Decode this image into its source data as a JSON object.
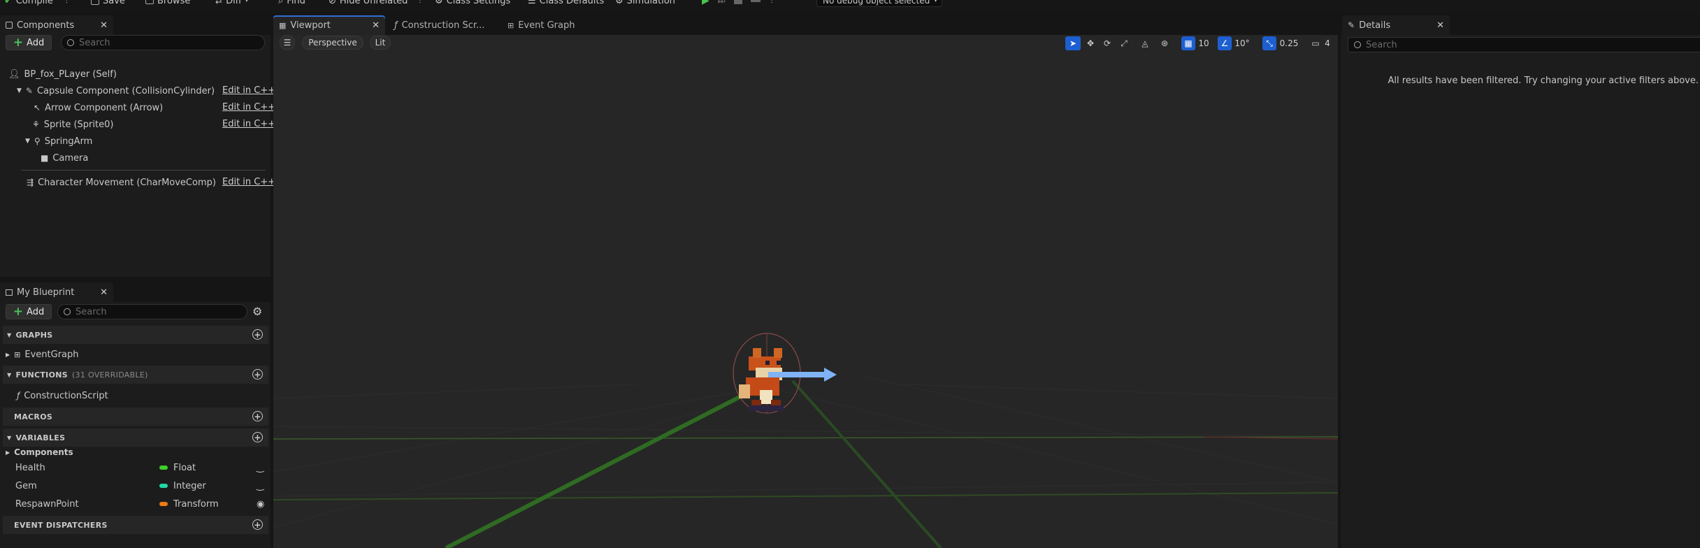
{
  "toolbar": {
    "items": [
      {
        "label": "Compile",
        "icon": "compile-icon"
      },
      {
        "label": "Save",
        "icon": "save-icon"
      },
      {
        "label": "Browse",
        "icon": "browse-icon"
      },
      {
        "label": "Diff",
        "icon": "diff-icon"
      },
      {
        "label": "Find",
        "icon": "find-icon"
      },
      {
        "label": "Hide Unrelated",
        "icon": "hide-unrelated-icon"
      },
      {
        "label": "Class Settings",
        "icon": "class-settings-icon"
      },
      {
        "label": "Class Defaults",
        "icon": "class-defaults-icon"
      },
      {
        "label": "Simulation",
        "icon": "simulation-icon"
      }
    ],
    "debug_selector": "No debug object selected"
  },
  "components_panel": {
    "tab_label": "Components",
    "add_label": "Add",
    "search_placeholder": "Search",
    "root": "BP_fox_PLayer (Self)",
    "items": [
      {
        "label": "Capsule Component (CollisionCylinder)",
        "edit": "Edit in C++"
      },
      {
        "label": "Arrow Component (Arrow)",
        "edit": "Edit in C++"
      },
      {
        "label": "Sprite (Sprite0)",
        "edit": "Edit in C++"
      },
      {
        "label": "SpringArm",
        "edit": ""
      },
      {
        "label": "Camera",
        "edit": ""
      },
      {
        "label": "Character Movement (CharMoveComp)",
        "edit": "Edit in C++"
      }
    ]
  },
  "my_blueprint": {
    "tab_label": "My Blueprint",
    "add_label": "Add",
    "search_placeholder": "Search",
    "sections": {
      "graphs": {
        "title": "GRAPHS",
        "items": [
          "EventGraph"
        ]
      },
      "functions": {
        "title": "FUNCTIONS",
        "subtitle": "(31 OVERRIDABLE)",
        "items": [
          "ConstructionScript"
        ]
      },
      "macros": {
        "title": "MACROS"
      },
      "variables": {
        "title": "VARIABLES",
        "category": "Components"
      },
      "dispatchers": {
        "title": "EVENT DISPATCHERS"
      }
    },
    "variables": [
      {
        "name": "Health",
        "type": "Float",
        "color": "#3fce2a",
        "visibility": "closed-eye-icon"
      },
      {
        "name": "Gem",
        "type": "Integer",
        "color": "#1fd8a6",
        "visibility": "closed-eye-icon"
      },
      {
        "name": "RespawnPoint",
        "type": "Transform",
        "color": "#f07b13",
        "visibility": "open-eye-icon"
      }
    ]
  },
  "editor_tabs": {
    "viewport": "Viewport",
    "construction": "Construction Scr...",
    "event_graph": "Event Graph"
  },
  "viewport": {
    "perspective": "Perspective",
    "lit": "Lit",
    "grid_snap": "10",
    "rotation_snap": "10°",
    "scale_snap": "0.25",
    "camera_speed": "4"
  },
  "details": {
    "tab_label": "Details",
    "search_placeholder": "Search",
    "message": "All results have been filtered. Try changing your active filters above."
  },
  "colors": {
    "accent": "#1d5fd1",
    "add_plus": "#48c35a",
    "arrow": "#7fb3f5"
  }
}
